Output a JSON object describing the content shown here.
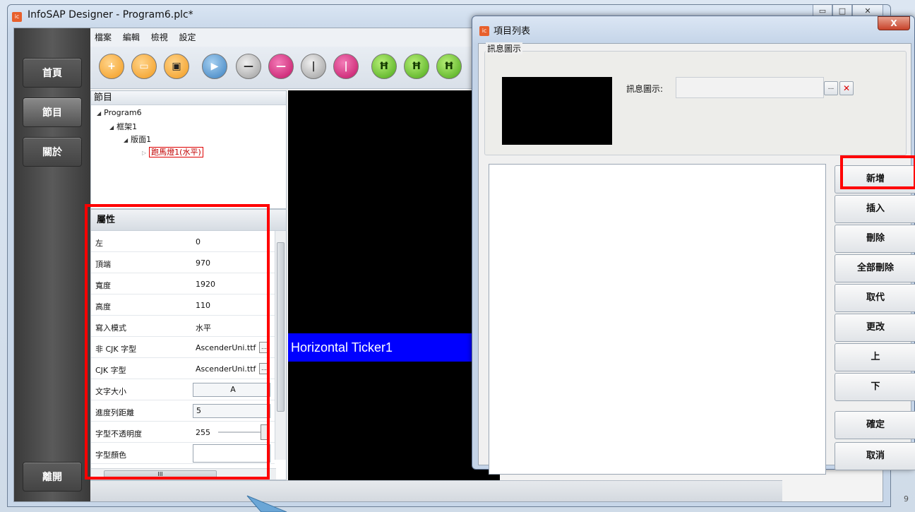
{
  "main_window": {
    "title": "InfoSAP Designer - Program6.plc*",
    "icon_label": "ic",
    "controls": {
      "minimize": "▭",
      "maximize": "□",
      "close": "✕"
    }
  },
  "nav": {
    "items": [
      {
        "label": "首頁"
      },
      {
        "label": "節目"
      },
      {
        "label": "關於"
      }
    ],
    "exit_label": "離開"
  },
  "menu": {
    "items": [
      "檔案",
      "編輯",
      "檢視",
      "設定"
    ]
  },
  "toolbar": {
    "icons": [
      "new-file-icon",
      "open-folder-icon",
      "save-icon",
      "play-icon",
      "horizontal-line-icon",
      "horizontal-ticker-icon",
      "vertical-line-icon",
      "vertical-ticker-icon",
      "film-frame-icon",
      "film-insert-icon",
      "film-move-icon"
    ]
  },
  "tree": {
    "header": "節目",
    "nodes": [
      {
        "label": "Program6"
      },
      {
        "label": "框架1"
      },
      {
        "label": "版面1"
      },
      {
        "label": "跑馬燈1(水平)"
      }
    ]
  },
  "properties": {
    "header": "屬性",
    "rows": [
      {
        "key": "左",
        "value": "0"
      },
      {
        "key": "頂端",
        "value": "970"
      },
      {
        "key": "寬度",
        "value": "1920"
      },
      {
        "key": "高度",
        "value": "110"
      },
      {
        "key": "寫入模式",
        "value": "水平"
      },
      {
        "key": "非 CJK 字型",
        "value": "AscenderUni.ttf"
      },
      {
        "key": "CJK 字型",
        "value": "AscenderUni.ttf"
      },
      {
        "key": "文字大小",
        "value": "A"
      },
      {
        "key": "進度列距離",
        "value": "5"
      },
      {
        "key": "字型不透明度",
        "value": "255"
      },
      {
        "key": "字型顏色",
        "value": ""
      }
    ],
    "hscroll_mark": "III"
  },
  "preview": {
    "ticker_text": "Horizontal Ticker1",
    "ticker_color": "#0000ff"
  },
  "dialog": {
    "icon_label": "ic",
    "title": "項目列表",
    "close": "X",
    "info_group_title": "訊息圖示",
    "info_label": "訊息圖示:",
    "info_value": "",
    "browse_label": "...",
    "clear_label": "✕",
    "buttons": [
      "新增",
      "插入",
      "刪除",
      "全部刪除",
      "取代",
      "更改",
      "上",
      "下"
    ],
    "ok_label": "確定",
    "cancel_label": "取消"
  },
  "corner_digit": "9",
  "highlight_color": "#ff0000"
}
